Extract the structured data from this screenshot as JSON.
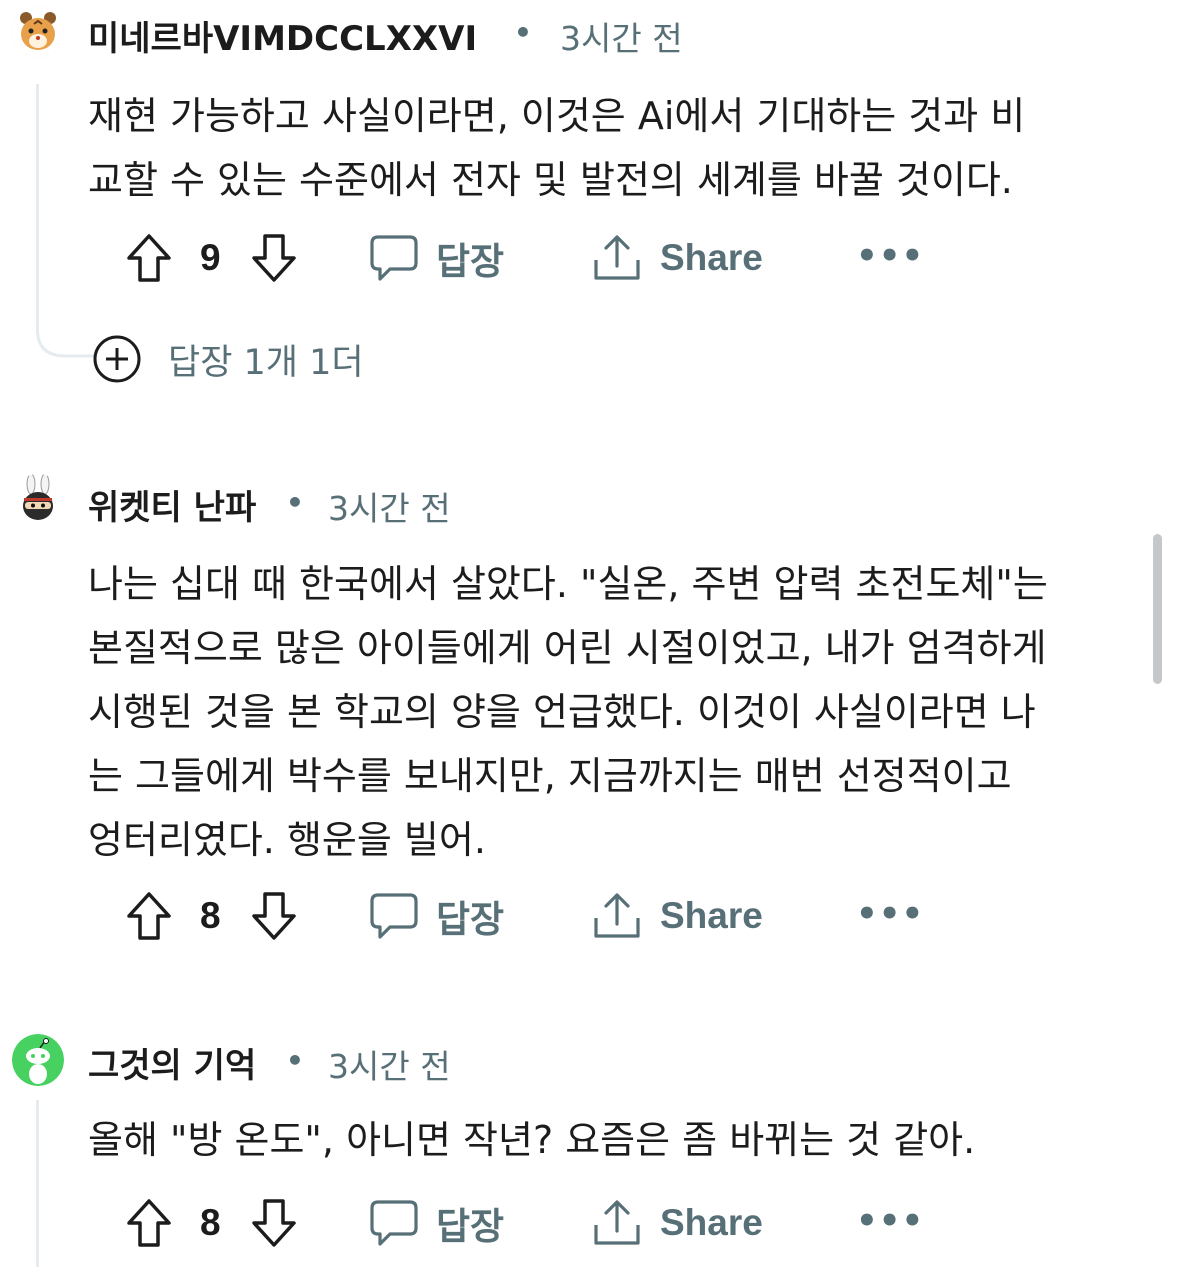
{
  "comments": [
    {
      "author": "미네르바VIMDCCLXXVI",
      "separator": "•",
      "time": "3시간 전",
      "avatar_icon": "tiger-avatar",
      "text": "재현 가능하고 사실이라면, 이것은 Ai에서 기대하는 것과 비\n교할 수 있는 수준에서 전자 및 발전의 세계를 바꿀 것이다.",
      "votes": "9",
      "reply_label": "답장",
      "share_label": "Share",
      "more_label": "•••",
      "more_replies": "답장 1개 1더"
    },
    {
      "author": "위켓티 난파",
      "separator": "•",
      "time": "3시간 전",
      "avatar_icon": "ninja-bunny-avatar",
      "text": "나는 십대 때 한국에서 살았다. \"실온, 주변 압력 초전도체\"는\n본질적으로 많은 아이들에게 어린 시절이었고, 내가 엄격하게\n시행된 것을 본 학교의 양을 언급했다. 이것이 사실이라면 나\n는 그들에게 박수를 보내지만, 지금까지는 매번 선정적이고\n엉터리였다. 행운을 빌어.",
      "votes": "8",
      "reply_label": "답장",
      "share_label": "Share",
      "more_label": "•••"
    },
    {
      "author": "그것의 기억",
      "separator": "•",
      "time": "3시간 전",
      "avatar_icon": "snoo-avatar",
      "text": "올해 \"방 온도\", 아니면 작년? 요즘은 좀 바뀌는 것 같아.",
      "votes": "8",
      "reply_label": "답장",
      "share_label": "Share",
      "more_label": "•••"
    }
  ],
  "colors": {
    "text": "#1c1c1c",
    "meta": "#576f76",
    "thread": "#e5ebee",
    "snoo_bg": "#46d160"
  }
}
